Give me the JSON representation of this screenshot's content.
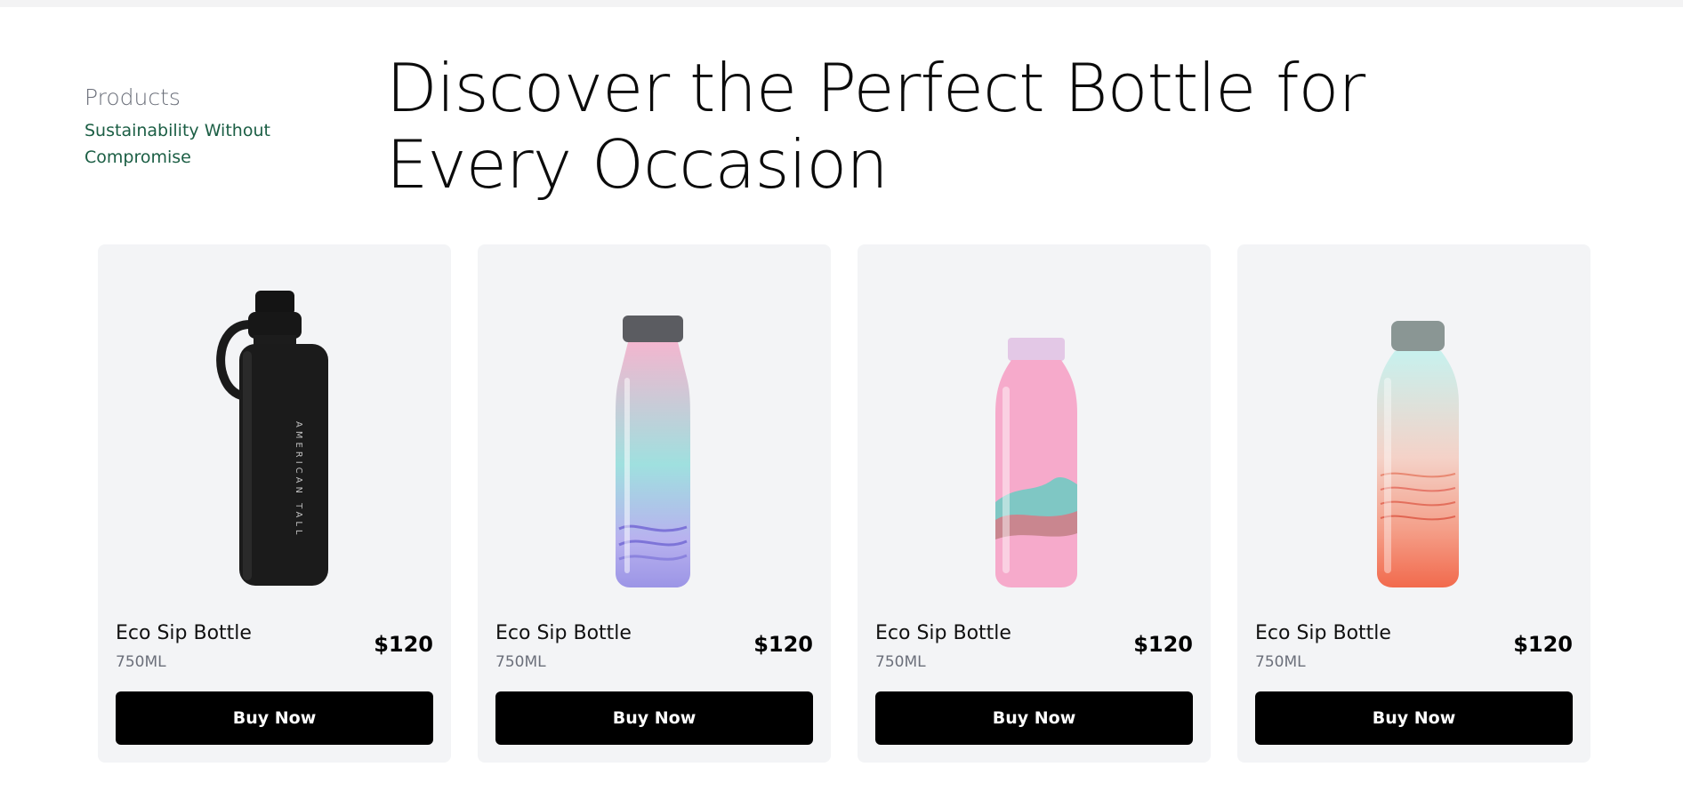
{
  "section": {
    "kicker": "Products",
    "tagline": "Sustainability Without Compromise",
    "headline": "Discover the Perfect Bottle for Every Occasion"
  },
  "products": [
    {
      "name": "Eco Sip Bottle",
      "size": "750ML",
      "price": "$120",
      "cta": "Buy Now",
      "image": "black-bottle-icon",
      "bottle_text": "AMERICAN TALL",
      "colors": {
        "body": "#1b1b1b",
        "cap": "#111111"
      }
    },
    {
      "name": "Eco Sip Bottle",
      "size": "750ML",
      "price": "$120",
      "cta": "Buy Now",
      "image": "pastel-glass-bottle-icon",
      "colors": {
        "top": "#f3b6cf",
        "mid": "#9fe0df",
        "bottom": "#9c95e6",
        "cap": "#5b5c61"
      }
    },
    {
      "name": "Eco Sip Bottle",
      "size": "750ML",
      "price": "$120",
      "cta": "Buy Now",
      "image": "pink-mountain-bottle-icon",
      "colors": {
        "body": "#f6aacb",
        "accent": "#7fc7c4",
        "cap": "#e3c8e6"
      }
    },
    {
      "name": "Eco Sip Bottle",
      "size": "750ML",
      "price": "$120",
      "cta": "Buy Now",
      "image": "gradient-wave-bottle-icon",
      "colors": {
        "top": "#c7f1ee",
        "mid": "#f4b8b0",
        "bottom": "#f26a4d",
        "cap": "#8a9694"
      }
    }
  ]
}
